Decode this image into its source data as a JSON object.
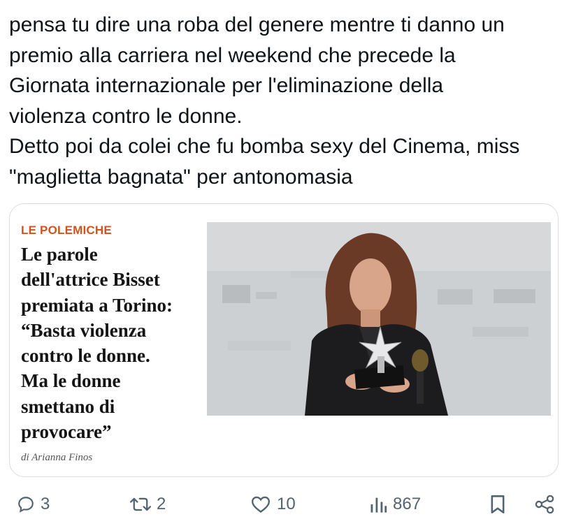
{
  "tweet": {
    "lines": [
      "pensa tu dire una roba del genere mentre ti danno un",
      "premio alla carriera nel weekend che precede la",
      "Giornata internazionale per l'eliminazione della",
      "violenza contro le donne.",
      "Detto poi da colei che fu bomba sexy del Cinema, miss",
      "\"maglietta bagnata\" per antonomasia"
    ]
  },
  "card": {
    "kicker": "LE POLEMICHE",
    "headline_lines": [
      "Le parole",
      "dell'attrice Bisset",
      "premiata a Torino:",
      "“Basta violenza",
      "contro le donne.",
      "Ma le donne",
      "smettano di",
      "provocare”"
    ],
    "author": "di Arianna Finos",
    "photo_icon": "woman-holding-star-award-photo"
  },
  "actions": {
    "reply": {
      "icon": "reply-icon",
      "count": "3"
    },
    "retweet": {
      "icon": "retweet-icon",
      "count": "2"
    },
    "like": {
      "icon": "heart-icon",
      "count": "10"
    },
    "views": {
      "icon": "views-chart-icon",
      "count": "867"
    },
    "bookmark": {
      "icon": "bookmark-icon"
    },
    "share": {
      "icon": "share-icon"
    }
  },
  "colors": {
    "text": "#0f1419",
    "secondary": "#536471",
    "kicker": "#d4531c",
    "border": "#d9dde1"
  }
}
